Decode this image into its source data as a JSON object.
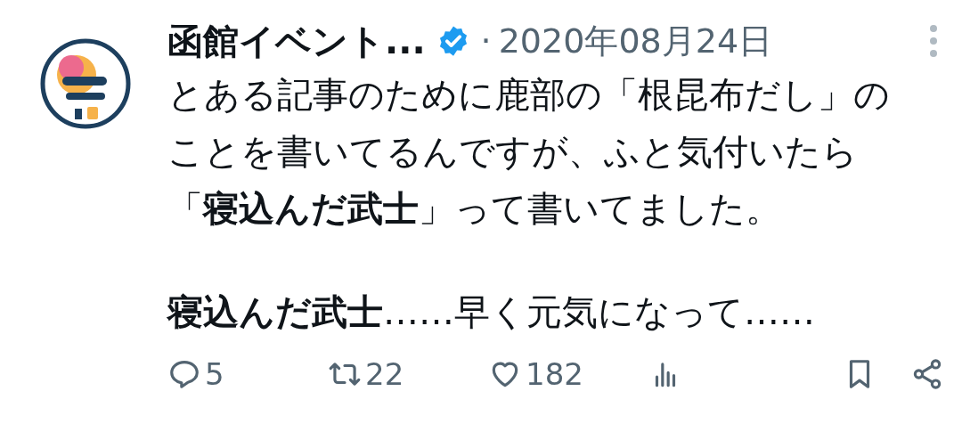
{
  "tweet": {
    "author": "函館イベント...",
    "verified": true,
    "separator": "·",
    "date": "2020年08月24日",
    "paragraphs": [
      "とある記事のために鹿部の「根昆布だし」のことを書いてるんですが、ふと気付いたら「**寝込んだ武士**」って書いてました。",
      "**寝込んだ武士**……早く元気になって……"
    ],
    "actions": [
      {
        "kind": "reply",
        "count": "5"
      },
      {
        "kind": "repost",
        "count": "22"
      },
      {
        "kind": "like",
        "count": "182"
      },
      {
        "kind": "views"
      },
      {
        "kind": "bookmark"
      },
      {
        "kind": "share"
      }
    ]
  }
}
